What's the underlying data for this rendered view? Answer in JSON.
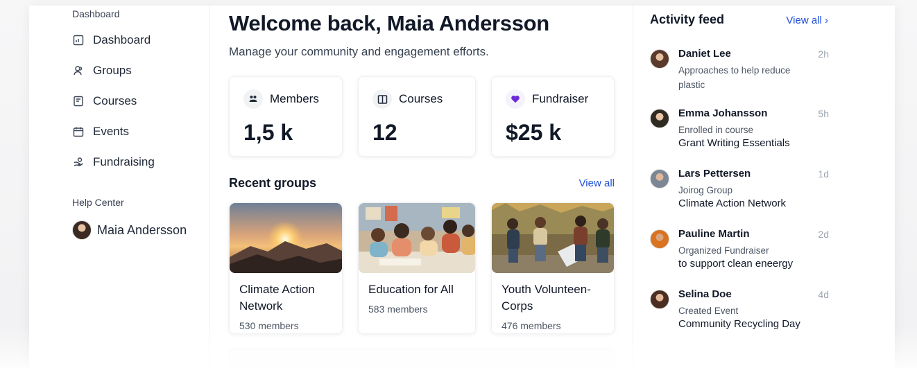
{
  "sidebar": {
    "section_dashboard": "Dashboard",
    "items": [
      {
        "label": "Dashboard",
        "icon": "dashboard-icon"
      },
      {
        "label": "Groups",
        "icon": "groups-icon"
      },
      {
        "label": "Courses",
        "icon": "courses-icon"
      },
      {
        "label": "Events",
        "icon": "calendar-icon"
      },
      {
        "label": "Fundraising",
        "icon": "fundraising-icon"
      }
    ],
    "section_help": "Help Center",
    "user_name": "Maia Andersson"
  },
  "main": {
    "title": "Welcome back, Maia Andersson",
    "subtitle": "Manage your community and engagement efforts.",
    "stats": [
      {
        "label": "Members",
        "value": "1,5 k",
        "icon": "members-icon"
      },
      {
        "label": "Courses",
        "value": "12",
        "icon": "book-icon"
      },
      {
        "label": "Fundraiser",
        "value": "$25 k",
        "icon": "heart-icon"
      }
    ],
    "recent_groups_title": "Recent groups",
    "recent_groups_link": "View all",
    "groups": [
      {
        "name": "Climate Action Network",
        "members": "530 members"
      },
      {
        "name": "Education for All",
        "members": "583 members"
      },
      {
        "name": "Youth Volunteen-Corps",
        "members": "476 members"
      }
    ]
  },
  "activity": {
    "title": "Activity feed",
    "link": "View all ›",
    "items": [
      {
        "name": "Daniet Lee",
        "time": "2h",
        "action": "Approaches to help reduce plastic",
        "object": ""
      },
      {
        "name": "Emma Johansson",
        "time": "5h",
        "action": "Enrolled in course",
        "object": "Grant Writing Essentials"
      },
      {
        "name": "Lars Pettersen",
        "time": "1d",
        "action": "Joirog Group",
        "object": "Climate Action Network"
      },
      {
        "name": "Pauline Martin",
        "time": "2d",
        "action": "Organized Fundraiser",
        "object": "to support clean eneergy"
      },
      {
        "name": "Selina Doe",
        "time": "4d",
        "action": "Created Event",
        "object": "Community Recycling Day"
      }
    ]
  },
  "colors": {
    "accent": "#1d4ed8",
    "heart": "#6d28d9"
  }
}
